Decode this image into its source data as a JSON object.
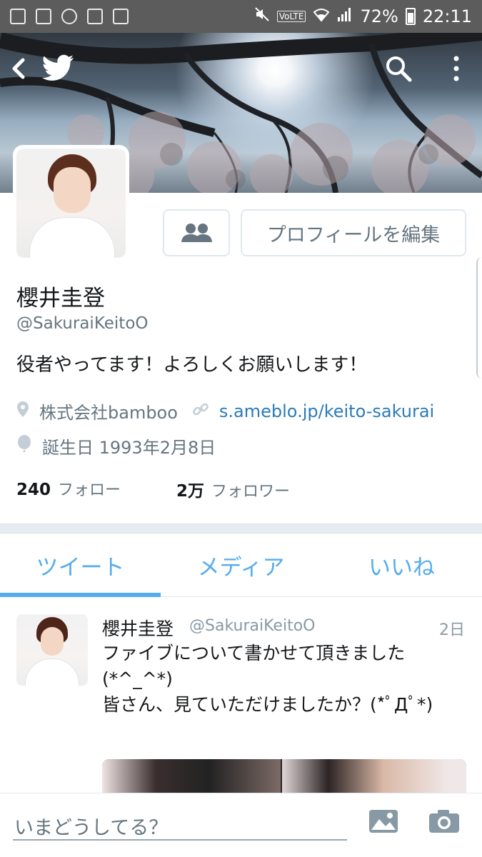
{
  "status_bar": {
    "lte": "VoLTE",
    "battery_percent": "72%",
    "time": "22:11"
  },
  "header": {
    "back_icon": "back-arrow-icon",
    "logo_icon": "twitter-bird-icon",
    "search_icon": "search-icon",
    "menu_icon": "more-vertical-icon"
  },
  "profile": {
    "name": "櫻井圭登",
    "handle": "@SakuraiKeitoO",
    "bio": "役者やってます！よろしくお願いします！",
    "location": "株式会社bamboo",
    "website": "s.ameblo.jp/keito-sakurai",
    "birthday": "誕生日 1993年2月8日",
    "edit_button": "プロフィールを編集",
    "following_count": "240",
    "following_label": "フォロー",
    "followers_count": "2万",
    "followers_label": "フォロワー"
  },
  "tabs": [
    {
      "label": "ツイート",
      "active": true
    },
    {
      "label": "メディア",
      "active": false
    },
    {
      "label": "いいね",
      "active": false
    }
  ],
  "tweet": {
    "author_name": "櫻井圭登",
    "author_handle": "@SakuraiKeitoO",
    "time": "2日",
    "text": "ファイブについて書かせて頂きました(*^_^*)\n皆さん、見ていただけましたか？(*ﾟДﾟ*)"
  },
  "compose": {
    "placeholder": "いまどうしてる？"
  },
  "colors": {
    "accent": "#55acee",
    "link": "#2b7bb9",
    "text": "#14171a",
    "secondary": "#66757f"
  }
}
